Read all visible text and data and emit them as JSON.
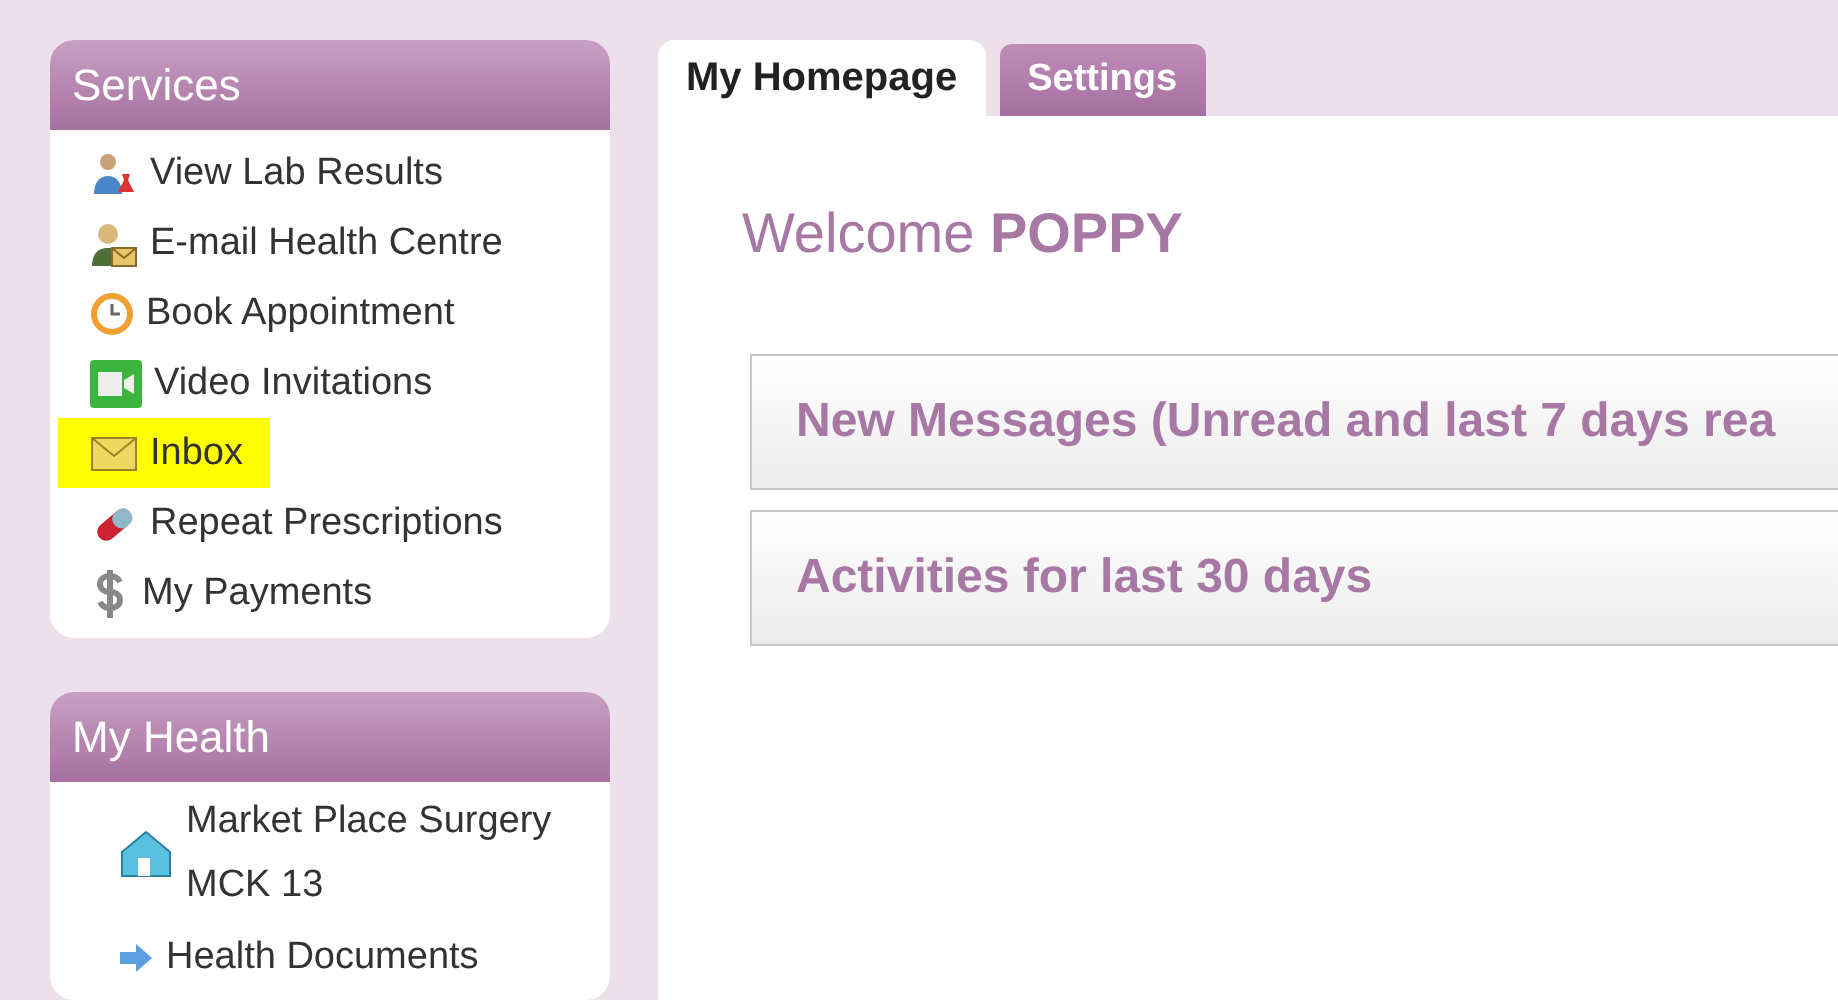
{
  "sidebar": [
    {
      "title": "Services",
      "items": [
        {
          "label": "View Lab Results",
          "highlighted": false
        },
        {
          "label": "E-mail Health Centre",
          "highlighted": false
        },
        {
          "label": "Book Appointment",
          "highlighted": false
        },
        {
          "label": "Video Invitations",
          "highlighted": false
        },
        {
          "label": "Inbox",
          "highlighted": true
        },
        {
          "label": "Repeat Prescriptions",
          "highlighted": false
        },
        {
          "label": "My Payments",
          "highlighted": false
        }
      ]
    },
    {
      "title": "My Health",
      "items": [
        {
          "label": "Market Place Surgery MCK 13",
          "highlighted": false
        },
        {
          "label": "Health Documents",
          "highlighted": false
        }
      ]
    }
  ],
  "tabs": [
    {
      "label": "My Homepage",
      "selected": true
    },
    {
      "label": "Settings",
      "selected": false
    }
  ],
  "welcome": {
    "greeting": "Welcome",
    "name": "POPPY"
  },
  "sections": [
    {
      "title": "New Messages (Unread and last 7 days rea"
    },
    {
      "title": "Activities for last 30 days"
    }
  ]
}
